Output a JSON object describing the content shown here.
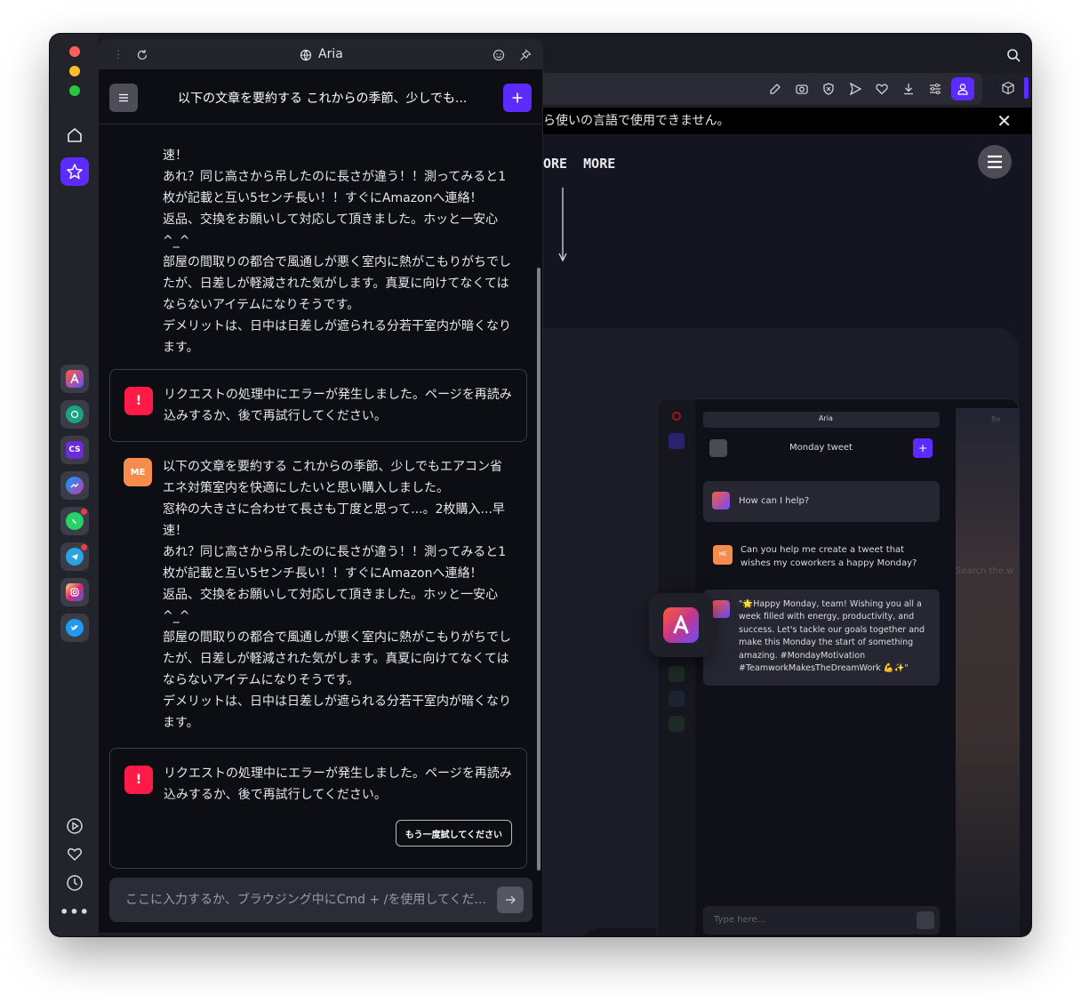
{
  "panel": {
    "title": "Aria",
    "chat_title": "以下の文章を要約する これからの季節、少しでも..."
  },
  "toolbar": {
    "notice": "ら使いの言語で使用できません。",
    "page_heading": "ORE  MORE"
  },
  "messages": {
    "tail_lines": [
      "速！",
      "あれ？同じ高さから吊したのに長さが違う！！測ってみると1",
      "枚が記載と互い5センチ長い！！すぐにAmazonへ連絡！",
      "返品、交換をお願いして対応して頂きました。ホッと一安心",
      "^_^",
      "部屋の間取りの都合で風通しが悪く室内に熱がこもりがちでし",
      "たが、日差しが軽減された気がします。真夏に向けてなくては",
      "ならないアイテムになりそうです。",
      "デメリットは、日中は日差しが遮られる分若干室内が暗くなり",
      "ます。"
    ],
    "error1": "リクエストの処理中にエラーが発生しました。ページを再読み込みするか、後で再試行してください。",
    "user_avatar": "ME",
    "user_lines": [
      "以下の文章を要約する これからの季節、少しでもエアコン省",
      "エネ対策室内を快適にしたいと思い購入しました。",
      "窓枠の大きさに合わせて長さも丁度と思って...。2枚購入...早",
      "速！",
      "あれ？同じ高さから吊したのに長さが違う！！測ってみると1",
      "枚が記載と互い5センチ長い！！すぐにAmazonへ連絡！",
      "返品、交換をお願いして対応して頂きました。ホッと一安心",
      "^_^",
      "部屋の間取りの都合で風通しが悪く室内に熱がこもりがちでし",
      "たが、日差しが軽減された気がします。真夏に向けてなくては",
      "ならないアイテムになりそうです。",
      "デメリットは、日中は日差しが遮られる分若干室内が暗くなり",
      "ます。"
    ],
    "error2": "リクエストの処理中にエラーが発生しました。ページを再読み込みするか、後で再試行してください。",
    "error_icon": "!",
    "retry_label": "もう一度試してください"
  },
  "input": {
    "placeholder": "ここに入力するか、ブラウジング中にCmd + /を使用してくだ..."
  },
  "preview": {
    "title": "Aria",
    "chat_title": "Monday tweet",
    "greeting": "How can I help?",
    "user_avatar": "ME",
    "user_msg_1": "Can you help me create a tweet that",
    "user_msg_2": "wishes my coworkers a happy Monday?",
    "reply_lines": [
      "\"🌟Happy Monday, team! Wishing you all a",
      "week filled with energy, productivity, and",
      "success. Let's tackle our goals together and",
      "make this Monday the start of something",
      "amazing. #MondayMotivation",
      "#TeamworkMakesTheDreamWork 💪✨\""
    ],
    "placeholder": "Type here...",
    "search_text": "Search the w",
    "tab_label": "Be"
  }
}
